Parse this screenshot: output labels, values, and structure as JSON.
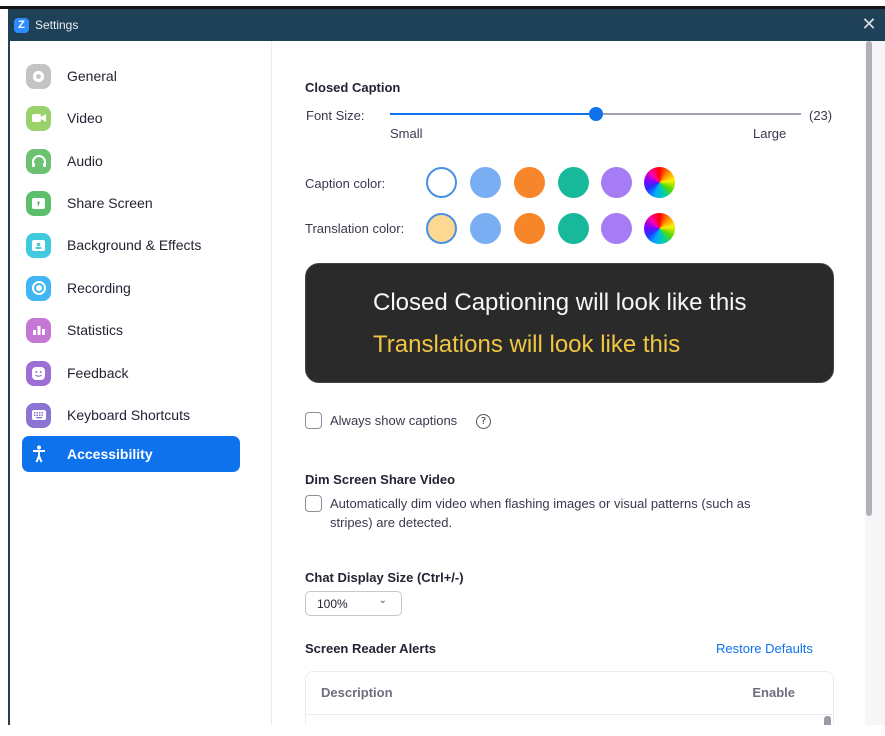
{
  "window": {
    "title": "Settings",
    "app_logo_letter": "Z",
    "close_glyph": "✕"
  },
  "sidebar": {
    "items": [
      {
        "label": "General",
        "icon": "gear-icon",
        "color": "#c4c4c4",
        "active": false
      },
      {
        "label": "Video",
        "icon": "video-camera-icon",
        "color": "#99d16b",
        "active": false
      },
      {
        "label": "Audio",
        "icon": "headphones-icon",
        "color": "#6cc172",
        "active": false
      },
      {
        "label": "Share Screen",
        "icon": "share-screen-icon",
        "color": "#5cbf6b",
        "active": false
      },
      {
        "label": "Background & Effects",
        "icon": "background-icon",
        "color": "#41c9e0",
        "active": false
      },
      {
        "label": "Recording",
        "icon": "recording-icon",
        "color": "#42b6f5",
        "active": false
      },
      {
        "label": "Statistics",
        "icon": "statistics-icon",
        "color": "#c477d4",
        "active": false
      },
      {
        "label": "Feedback",
        "icon": "feedback-smiley-icon",
        "color": "#9d6fd6",
        "active": false
      },
      {
        "label": "Keyboard Shortcuts",
        "icon": "keyboard-icon",
        "color": "#8b74d4",
        "active": false
      },
      {
        "label": "Accessibility",
        "icon": "accessibility-icon",
        "color": "#0e72ed",
        "active": true
      }
    ]
  },
  "closed_caption": {
    "heading": "Closed Caption",
    "font_size_label": "Font Size:",
    "font_size_value": 23,
    "font_size_value_text": "(23)",
    "slider_fraction": 0.5,
    "min_label": "Small",
    "max_label": "Large",
    "caption_color_label": "Caption color:",
    "translation_color_label": "Translation color:",
    "caption_colors": [
      "#ffffff",
      "#7aaef2",
      "#f7862a",
      "#17b99a",
      "#a67cf5",
      "rainbow"
    ],
    "caption_selected": 0,
    "translation_colors": [
      "#fdd892",
      "#7aaef2",
      "#f7862a",
      "#17b99a",
      "#a67cf5",
      "rainbow"
    ],
    "translation_selected": 0,
    "preview_caption": "Closed Captioning will look like this",
    "preview_translation": "Translations will look like this",
    "always_show_label": "Always show captions",
    "always_show_checked": false,
    "help_glyph": "?"
  },
  "dim_screen": {
    "heading": "Dim Screen Share Video",
    "option_label_line1": "Automatically dim video when flashing images or visual patterns (such as",
    "option_label_line2": "stripes) are detected.",
    "checked": false
  },
  "chat_display": {
    "heading": "Chat Display Size (Ctrl+/-)",
    "selected": "100%",
    "chevron_glyph": "⌄"
  },
  "screen_reader": {
    "heading": "Screen Reader Alerts",
    "restore_label": "Restore Defaults",
    "columns": [
      "Description",
      "Enable"
    ]
  },
  "colors": {
    "accent": "#0e72ed",
    "titlebar": "#1e4157"
  }
}
